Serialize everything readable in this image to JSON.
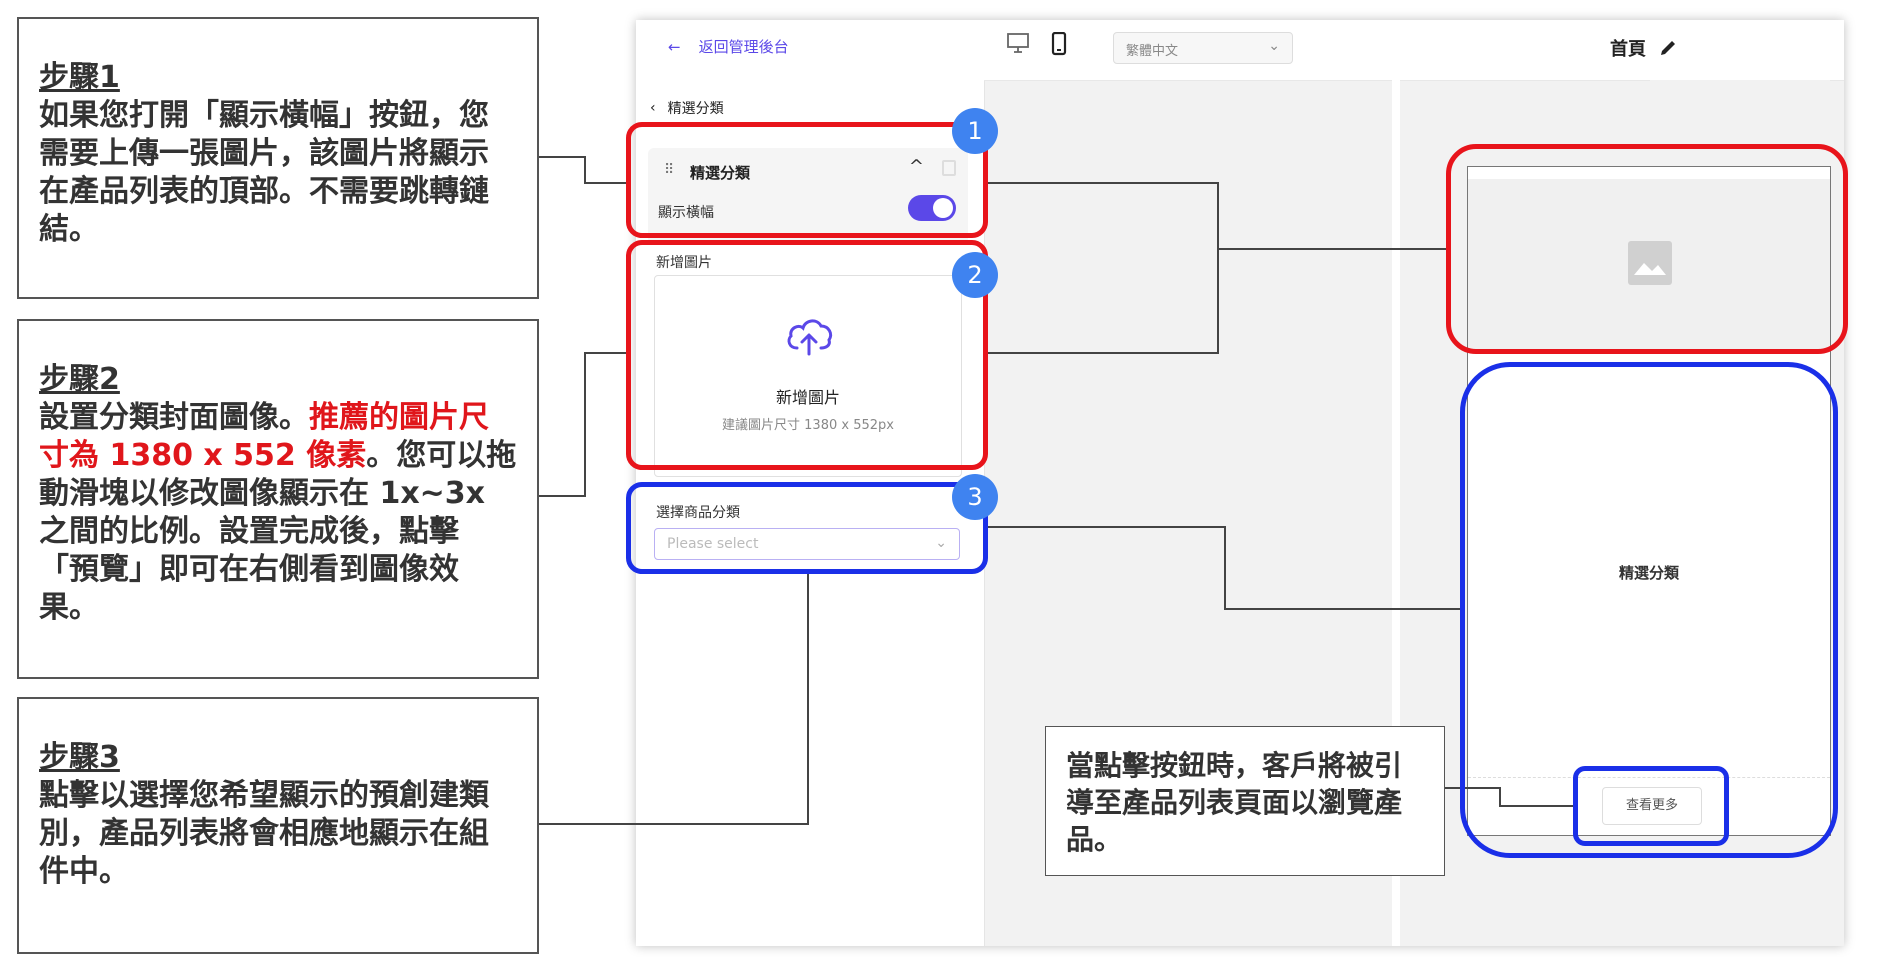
{
  "steps": [
    {
      "title": "步驟1",
      "text": "如果您打開「顯示橫幅」按鈕，您需要上傳一張圖片，該圖片將顯示在產品列表的頂部。不需要跳轉鏈結。"
    },
    {
      "title": "步驟2",
      "text_before": "設置分類封面圖像。",
      "text_red": "推薦的圖片尺寸為 1380 x 552 像素",
      "text_after": "。您可以拖動滑塊以修改圖像顯示在 1x~3x 之間的比例。設置完成後，點擊「預覽」即可在右側看到圖像效果。"
    },
    {
      "title": "步驟3",
      "text": "點擊以選擇您希望顯示的預創建類別，產品列表將會相應地顯示在組件中。"
    }
  ],
  "panel": {
    "back_link": "返回管理後台",
    "sub_back": "精選分類",
    "card_title": "精選分類",
    "banner_label": "顯示橫幅",
    "banner_toggle_on": true,
    "upload_label": "新增圖片",
    "upload_title": "新增圖片",
    "upload_hint": "建議圖片尺寸 1380 x 552px",
    "category_label": "選擇商品分類",
    "category_placeholder": "Please select"
  },
  "topbar": {
    "language": "繁體中文",
    "page_title": "首頁"
  },
  "preview": {
    "section_title": "精選分類",
    "view_more": "查看更多"
  },
  "callout": {
    "text": "當點擊按鈕時，客戶將被引導至產品列表頁面以瀏覽產品。"
  },
  "badges": [
    "1",
    "2",
    "3"
  ],
  "colors": {
    "accent": "#5b48e8",
    "highlight_red": "#e8141b",
    "highlight_blue": "#1a2fe8",
    "badge_blue": "#3f83f0"
  }
}
